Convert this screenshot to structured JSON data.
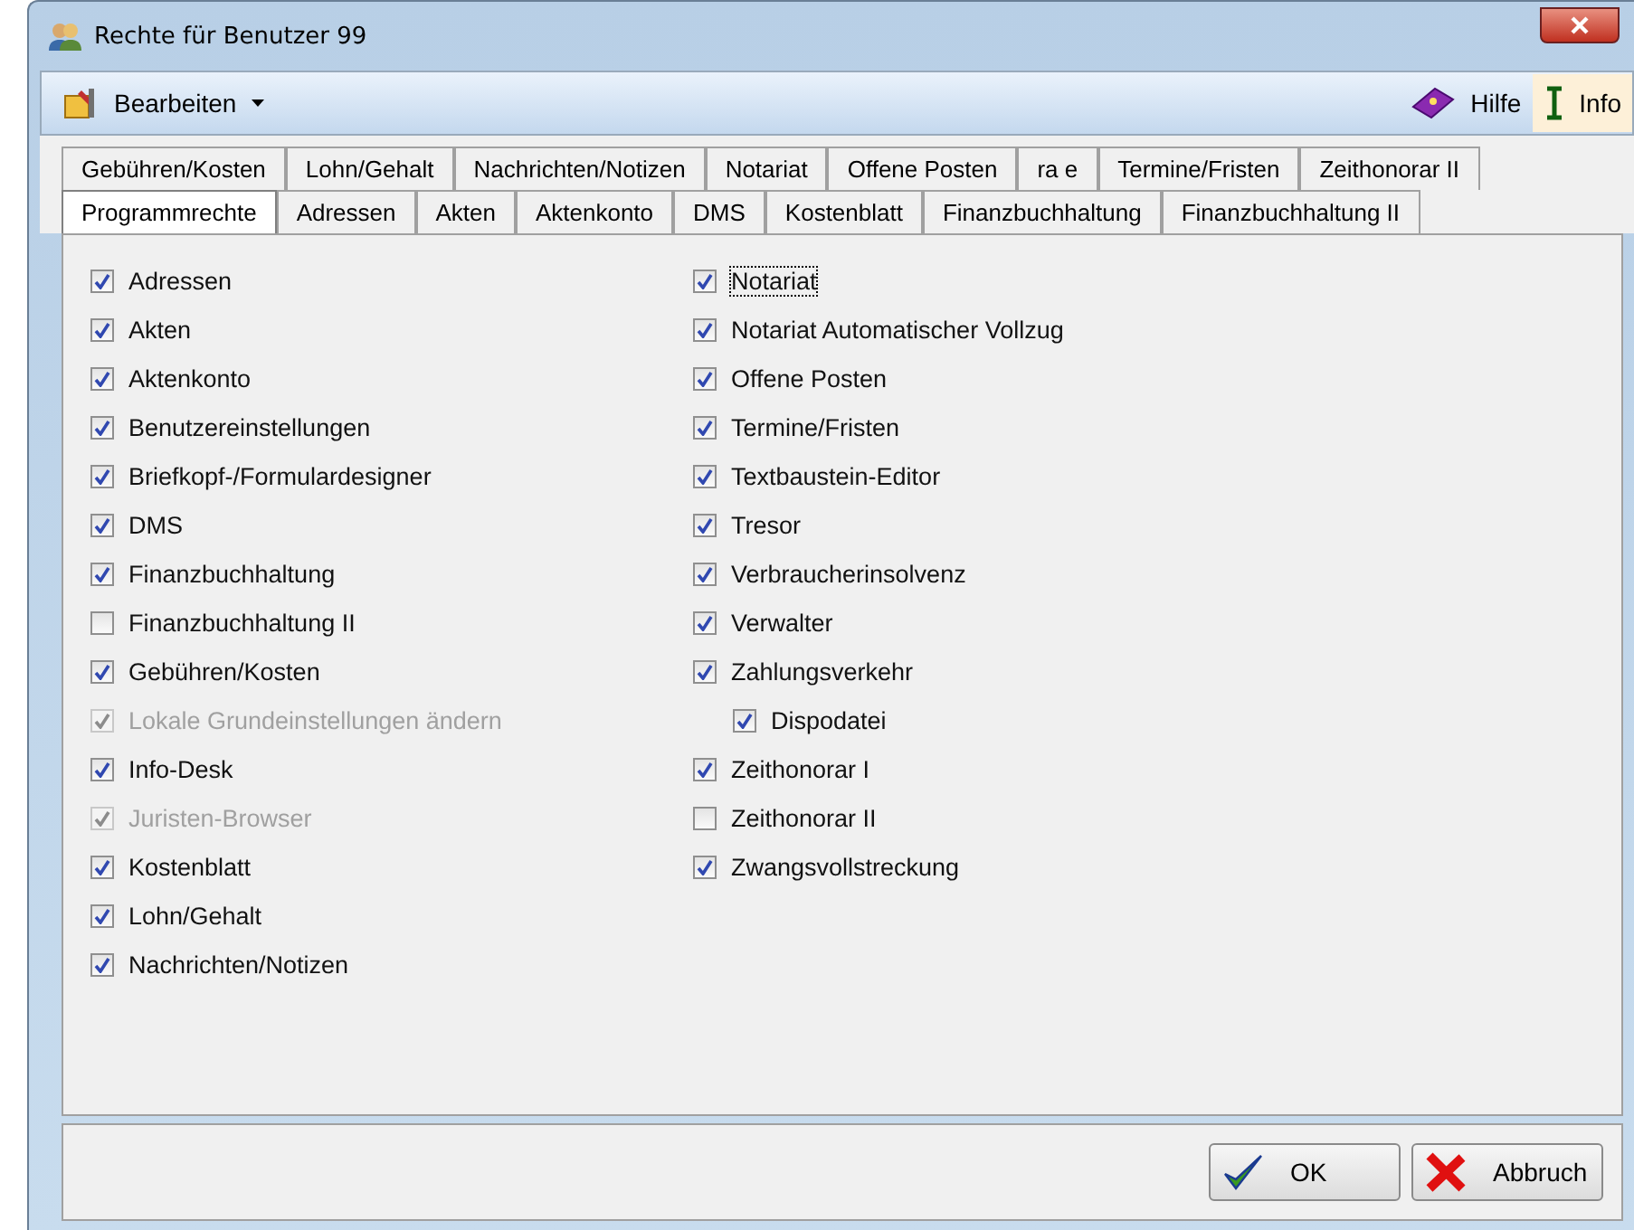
{
  "window": {
    "title": "Rechte für Benutzer 99"
  },
  "toolbar": {
    "menu": "Bearbeiten",
    "help": "Hilfe",
    "info": "Info"
  },
  "tab_rows": [
    [
      {
        "label": "Gebühren/Kosten",
        "selected": false
      },
      {
        "label": "Lohn/Gehalt",
        "selected": false
      },
      {
        "label": "Nachrichten/Notizen",
        "selected": false
      },
      {
        "label": "Notariat",
        "selected": false
      },
      {
        "label": "Offene Posten",
        "selected": false
      },
      {
        "label": "ra e",
        "selected": false
      },
      {
        "label": "Termine/Fristen",
        "selected": false
      },
      {
        "label": "Zeithonorar II",
        "selected": false
      }
    ],
    [
      {
        "label": "Programmrechte",
        "selected": true
      },
      {
        "label": "Adressen",
        "selected": false
      },
      {
        "label": "Akten",
        "selected": false
      },
      {
        "label": "Aktenkonto",
        "selected": false
      },
      {
        "label": "DMS",
        "selected": false
      },
      {
        "label": "Kostenblatt",
        "selected": false
      },
      {
        "label": "Finanzbuchhaltung",
        "selected": false
      },
      {
        "label": "Finanzbuchhaltung II",
        "selected": false
      }
    ]
  ],
  "columns": [
    [
      {
        "label": "Adressen",
        "checked": true,
        "disabled": false
      },
      {
        "label": "Akten",
        "checked": true,
        "disabled": false
      },
      {
        "label": "Aktenkonto",
        "checked": true,
        "disabled": false
      },
      {
        "label": "Benutzereinstellungen",
        "checked": true,
        "disabled": false
      },
      {
        "label": "Briefkopf-/Formulardesigner",
        "checked": true,
        "disabled": false
      },
      {
        "label": "DMS",
        "checked": true,
        "disabled": false
      },
      {
        "label": "Finanzbuchhaltung",
        "checked": true,
        "disabled": false
      },
      {
        "label": "Finanzbuchhaltung II",
        "checked": false,
        "disabled": false
      },
      {
        "label": "Gebühren/Kosten",
        "checked": true,
        "disabled": false
      },
      {
        "label": "Lokale Grundeinstellungen ändern",
        "checked": true,
        "disabled": true
      },
      {
        "label": "Info-Desk",
        "checked": true,
        "disabled": false
      },
      {
        "label": "Juristen-Browser",
        "checked": true,
        "disabled": true
      },
      {
        "label": "Kostenblatt",
        "checked": true,
        "disabled": false
      },
      {
        "label": "Lohn/Gehalt",
        "checked": true,
        "disabled": false
      },
      {
        "label": "Nachrichten/Notizen",
        "checked": true,
        "disabled": false
      }
    ],
    [
      {
        "label": "Notariat",
        "checked": true,
        "disabled": false,
        "focused": true
      },
      {
        "label": "Notariat Automatischer Vollzug",
        "checked": true,
        "disabled": false
      },
      {
        "label": "Offene Posten",
        "checked": true,
        "disabled": false
      },
      {
        "label": "Termine/Fristen",
        "checked": true,
        "disabled": false
      },
      {
        "label": "Textbaustein-Editor",
        "checked": true,
        "disabled": false
      },
      {
        "label": "Tresor",
        "checked": true,
        "disabled": false
      },
      {
        "label": "Verbraucherinsolvenz",
        "checked": true,
        "disabled": false
      },
      {
        "label": "Verwalter",
        "checked": true,
        "disabled": false
      },
      {
        "label": "Zahlungsverkehr",
        "checked": true,
        "disabled": false,
        "children": [
          {
            "label": "Dispodatei",
            "checked": true,
            "disabled": false
          }
        ]
      },
      {
        "label": "Zeithonorar I",
        "checked": true,
        "disabled": false
      },
      {
        "label": "Zeithonorar II",
        "checked": false,
        "disabled": false
      },
      {
        "label": "Zwangsvollstreckung",
        "checked": true,
        "disabled": false
      }
    ]
  ],
  "buttons": {
    "ok": "OK",
    "cancel": "Abbruch"
  }
}
